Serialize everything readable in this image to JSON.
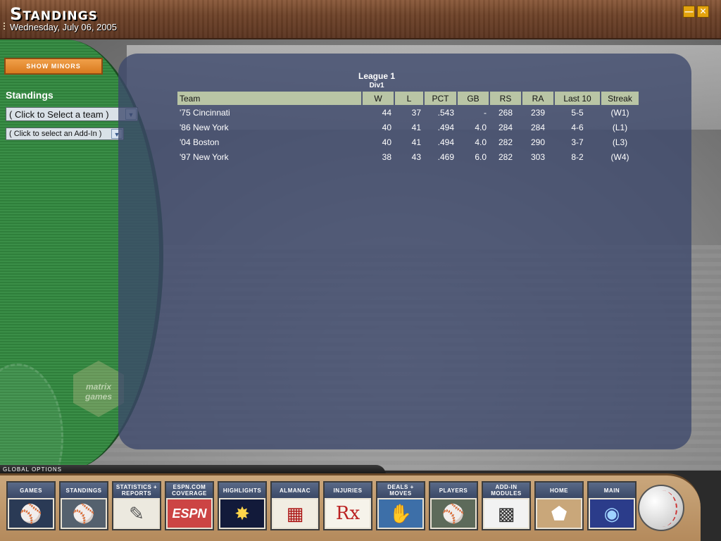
{
  "header": {
    "title": "Standings",
    "date": "Wednesday, July 06, 2005",
    "minimize_icon": "minimize-icon",
    "close_icon": "close-icon"
  },
  "sidebar": {
    "show_minors_label": "SHOW MINORS",
    "section_label": "Standings",
    "team_select": "( Click to Select a team )",
    "addin_select": "( Click to select an Add-In )",
    "logo_text": "matrix games"
  },
  "standings": {
    "league": "League 1",
    "division": "Div1",
    "columns": [
      "Team",
      "W",
      "L",
      "PCT",
      "GB",
      "RS",
      "RA",
      "Last 10",
      "Streak"
    ],
    "rows": [
      [
        "'75 Cincinnati",
        "44",
        "37",
        ".543",
        "-",
        "268",
        "239",
        "5-5",
        "(W1)"
      ],
      [
        "'86 New York",
        "40",
        "41",
        ".494",
        "4.0",
        "284",
        "284",
        "4-6",
        "(L1)"
      ],
      [
        "'04 Boston",
        "40",
        "41",
        ".494",
        "4.0",
        "282",
        "290",
        "3-7",
        "(L3)"
      ],
      [
        "'97 New York",
        "38",
        "43",
        ".469",
        "6.0",
        "282",
        "303",
        "8-2",
        "(W4)"
      ]
    ]
  },
  "global_options": {
    "label": "GLOBAL OPTIONS",
    "buttons": [
      {
        "label": "GAMES",
        "icon": "pitcher-icon"
      },
      {
        "label": "STANDINGS",
        "icon": "batter-icon"
      },
      {
        "label": "STATISTICS + REPORTS",
        "icon": "report-icon"
      },
      {
        "label": "ESPN.COM COVERAGE",
        "icon": "espn-icon"
      },
      {
        "label": "HIGHLIGHTS",
        "icon": "fireworks-icon"
      },
      {
        "label": "ALMANAC",
        "icon": "books-icon"
      },
      {
        "label": "INJURIES",
        "icon": "rx-icon"
      },
      {
        "label": "DEALS + MOVES",
        "icon": "handshake-icon"
      },
      {
        "label": "PLAYERS",
        "icon": "catcher-icon"
      },
      {
        "label": "ADD-IN MODULES",
        "icon": "laptop-icon"
      },
      {
        "label": "HOME",
        "icon": "home-plate-icon"
      },
      {
        "label": "MAIN",
        "icon": "main-screen-icon"
      }
    ],
    "ball_icon": "baseball-icon",
    "espn_text": "ESPN",
    "rx_text": "Rx"
  }
}
